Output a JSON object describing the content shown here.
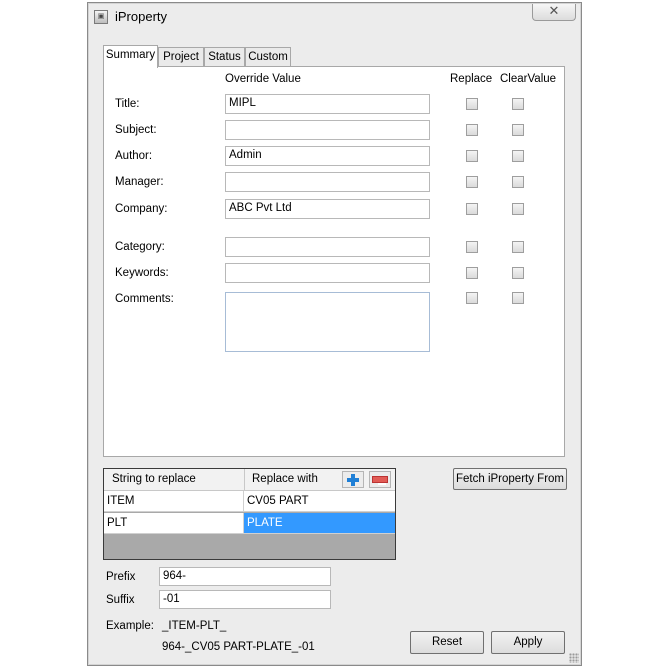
{
  "window": {
    "title": "iProperty",
    "icon": "app-icon",
    "close": "✕"
  },
  "tabs": [
    {
      "label": "Summary",
      "active": true
    },
    {
      "label": "Project",
      "active": false
    },
    {
      "label": "Status",
      "active": false
    },
    {
      "label": "Custom",
      "active": false
    }
  ],
  "summary": {
    "col_override": "Override Value",
    "col_replace": "Replace",
    "col_clear": "ClearValue",
    "fields": [
      {
        "label": "Title:",
        "value": "MIPL"
      },
      {
        "label": "Subject:",
        "value": ""
      },
      {
        "label": "Author:",
        "value": "Admin"
      },
      {
        "label": "Manager:",
        "value": ""
      },
      {
        "label": "Company:",
        "value": "ABC Pvt Ltd"
      },
      {
        "label": "Category:",
        "value": ""
      },
      {
        "label": "Keywords:",
        "value": ""
      },
      {
        "label": "Comments:",
        "value": ""
      }
    ]
  },
  "replace_table": {
    "col1": "String to replace",
    "col2": "Replace with",
    "add_icon": "plus-icon",
    "remove_icon": "minus-icon",
    "rows": [
      {
        "from": "ITEM",
        "to": "CV05 PART"
      },
      {
        "from": "PLT",
        "to": "PLATE"
      }
    ]
  },
  "fetch_button": "Fetch iProperty From",
  "prefix": {
    "label": "Prefix",
    "value": "964-"
  },
  "suffix": {
    "label": "Suffix",
    "value": "-01"
  },
  "example": {
    "label": "Example:",
    "pattern": "_ITEM-PLT_",
    "result": "964-_CV05 PART-PLATE_-01"
  },
  "buttons": {
    "reset": "Reset",
    "apply": "Apply"
  },
  "colors": {
    "selection": "#3399ff",
    "add": "#1f7fd6",
    "remove": "#e15b55"
  }
}
